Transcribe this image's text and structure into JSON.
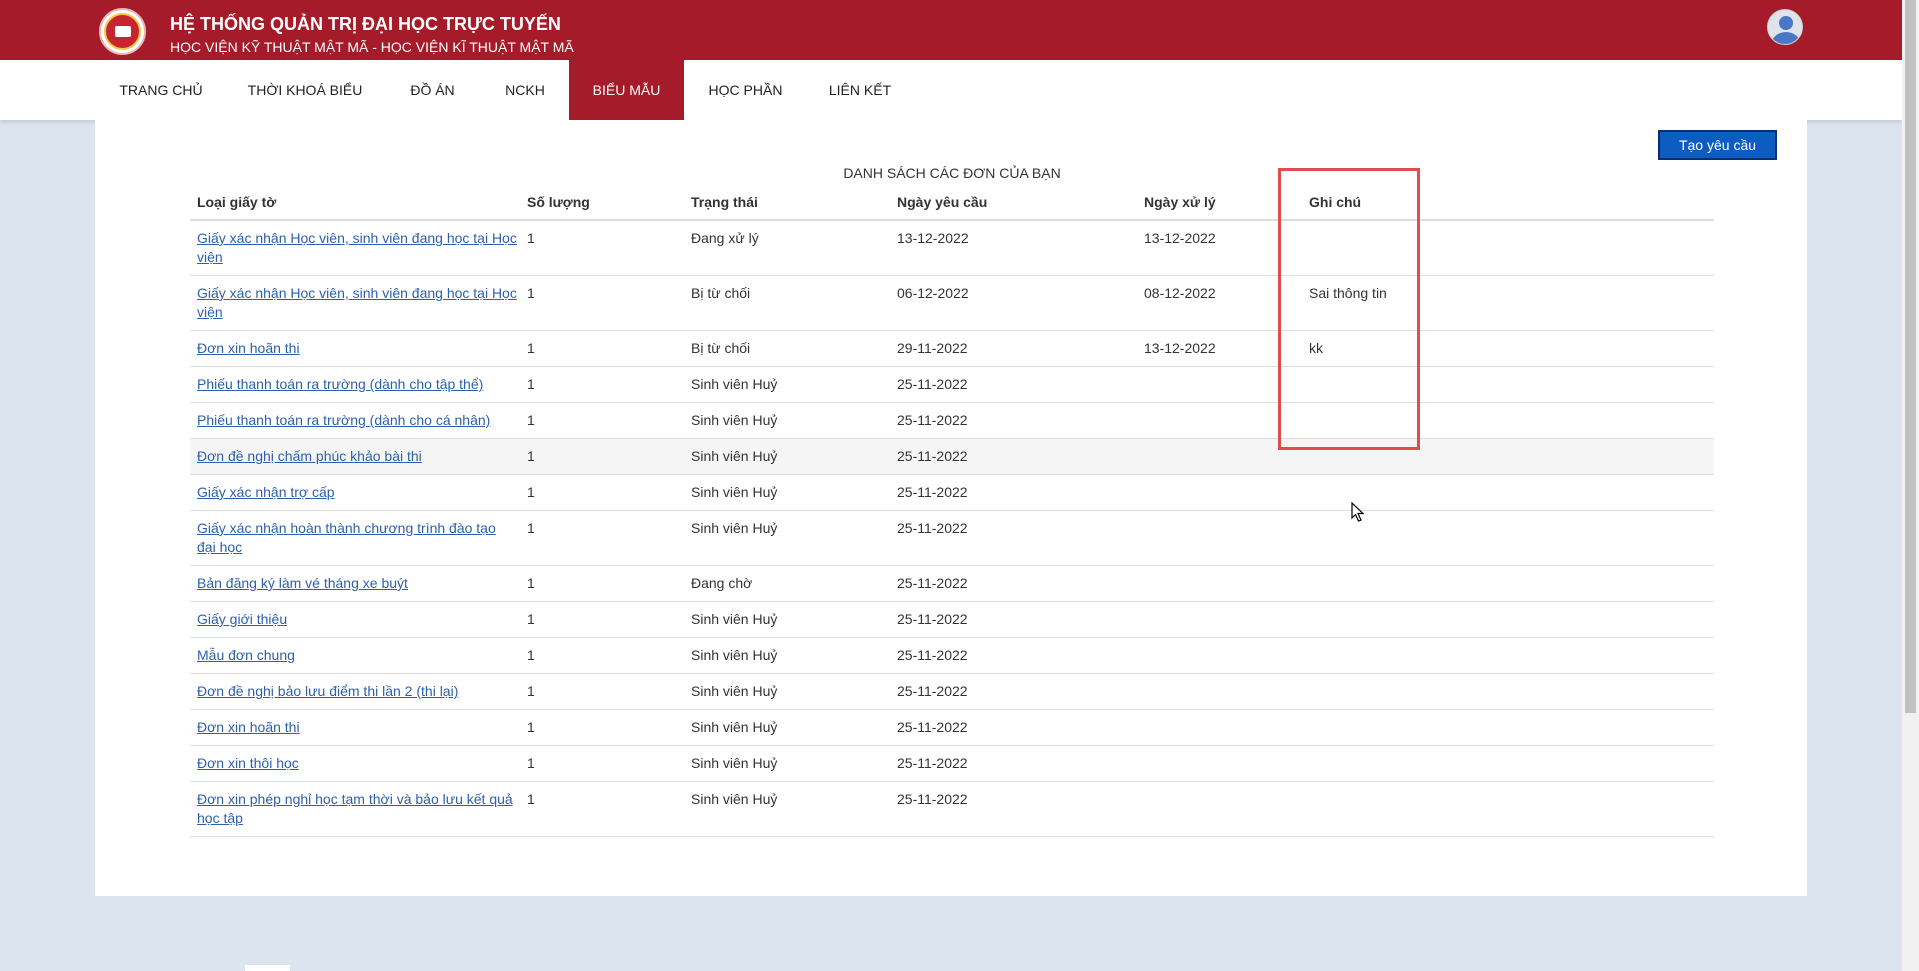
{
  "header": {
    "title": "HỆ THỐNG QUẢN TRỊ ĐẠI HỌC TRỰC TUYẾN",
    "subtitle": "HỌC VIỆN KỸ THUẬT MẬT MÃ - HỌC VIỆN KĨ THUẬT MẬT MÃ"
  },
  "nav": [
    {
      "label": "TRANG CHỦ"
    },
    {
      "label": "THỜI KHOÁ BIỂU"
    },
    {
      "label": "ĐỒ ÁN"
    },
    {
      "label": "NCKH"
    },
    {
      "label": "BIỂU MẪU",
      "active": true
    },
    {
      "label": "HỌC PHẦN"
    },
    {
      "label": "LIÊN KẾT"
    }
  ],
  "actions": {
    "create_label": "Tạo yêu cầu"
  },
  "table": {
    "caption": "DANH SÁCH CÁC ĐƠN CỦA BẠN",
    "headers": [
      "Loại giấy tờ",
      "Số lượng",
      "Trạng thái",
      "Ngày yêu cầu",
      "Ngày xử lý",
      "Ghi chú"
    ],
    "rows": [
      {
        "doc": "Giấy xác nhận Học viên, sinh viên đang học tại Học viện",
        "qty": "1",
        "status": "Đang xử lý",
        "requested": "13-12-2022",
        "processed": "13-12-2022",
        "note": ""
      },
      {
        "doc": "Giấy xác nhận Học viên, sinh viên đang học tại Học viện",
        "qty": "1",
        "status": "Bị từ chối",
        "requested": "06-12-2022",
        "processed": "08-12-2022",
        "note": "Sai thông tin"
      },
      {
        "doc": "Đơn xin hoãn thi",
        "qty": "1",
        "status": "Bị từ chối",
        "requested": "29-11-2022",
        "processed": "13-12-2022",
        "note": "kk"
      },
      {
        "doc": "Phiếu thanh toán ra trường (dành cho tập thể)",
        "qty": "1",
        "status": "Sinh viên Huỷ",
        "requested": "25-11-2022",
        "processed": "",
        "note": ""
      },
      {
        "doc": "Phiếu thanh toán ra trường (dành cho cá nhân)",
        "qty": "1",
        "status": "Sinh viên Huỷ",
        "requested": "25-11-2022",
        "processed": "",
        "note": ""
      },
      {
        "doc": "Đơn đề nghị chấm phúc khảo bài thi",
        "qty": "1",
        "status": "Sinh viên Huỷ",
        "requested": "25-11-2022",
        "processed": "",
        "note": ""
      },
      {
        "doc": "Giấy xác nhận trợ cấp",
        "qty": "1",
        "status": "Sinh viên Huỷ",
        "requested": "25-11-2022",
        "processed": "",
        "note": ""
      },
      {
        "doc": "Giấy xác nhận hoàn thành chương trình đào tạo đại học",
        "qty": "1",
        "status": "Sinh viên Huỷ",
        "requested": "25-11-2022",
        "processed": "",
        "note": ""
      },
      {
        "doc": "Bản đăng ký làm vé tháng xe buýt",
        "qty": "1",
        "status": "Đang chờ",
        "requested": "25-11-2022",
        "processed": "",
        "note": ""
      },
      {
        "doc": "Giấy giới thiệu",
        "qty": "1",
        "status": "Sinh viên Huỷ",
        "requested": "25-11-2022",
        "processed": "",
        "note": ""
      },
      {
        "doc": "Mẫu đơn chung",
        "qty": "1",
        "status": "Sinh viên Huỷ",
        "requested": "25-11-2022",
        "processed": "",
        "note": ""
      },
      {
        "doc": "Đơn đề nghị bảo lưu điểm thi lần 2 (thi lại)",
        "qty": "1",
        "status": "Sinh viên Huỷ",
        "requested": "25-11-2022",
        "processed": "",
        "note": ""
      },
      {
        "doc": "Đơn xin hoãn thi",
        "qty": "1",
        "status": "Sinh viên Huỷ",
        "requested": "25-11-2022",
        "processed": "",
        "note": ""
      },
      {
        "doc": "Đơn xin thôi học",
        "qty": "1",
        "status": "Sinh viên Huỷ",
        "requested": "25-11-2022",
        "processed": "",
        "note": ""
      },
      {
        "doc": "Đơn xin phép nghỉ học tạm thời và bảo lưu kết quả học tập",
        "qty": "1",
        "status": "Sinh viên Huỷ",
        "requested": "25-11-2022",
        "processed": "",
        "note": ""
      }
    ]
  },
  "colors": {
    "brand": "#a61b2a",
    "primary_button": "#0d5cc2",
    "link": "#2d5fb0",
    "annotation": "#e04d4d"
  },
  "icons": {
    "logo": "academy-logo-icon",
    "avatar": "user-avatar-icon",
    "cursor": "mouse-pointer-icon"
  }
}
